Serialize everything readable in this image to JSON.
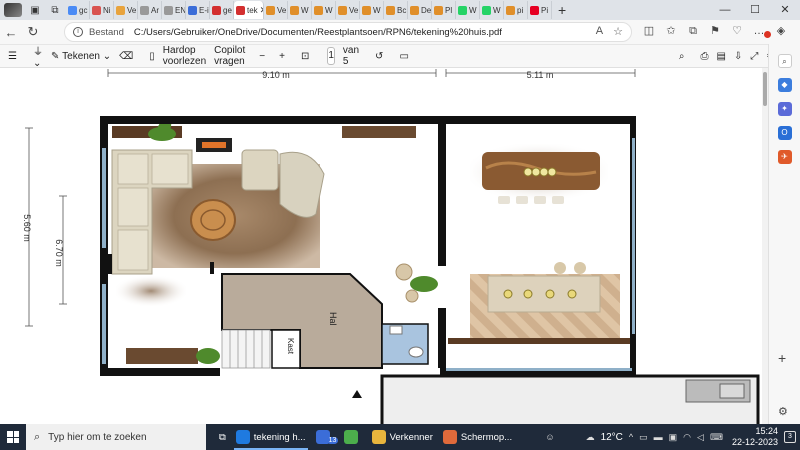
{
  "browser": {
    "tabs": [
      {
        "label": "gc",
        "color": "#4b8bf5"
      },
      {
        "label": "Ni",
        "color": "#d9534f"
      },
      {
        "label": "Ve",
        "color": "#e8a33d"
      },
      {
        "label": "Ar",
        "color": "#999999"
      },
      {
        "label": "EN",
        "color": "#999999"
      },
      {
        "label": "E-i",
        "color": "#3b6dd8"
      },
      {
        "label": "ge",
        "color": "#d32f2f"
      },
      {
        "label": "tek",
        "color": "#d32f2f",
        "active": true
      },
      {
        "label": "Ve",
        "color": "#e08f2a"
      },
      {
        "label": "W",
        "color": "#e08f2a"
      },
      {
        "label": "W",
        "color": "#e08f2a"
      },
      {
        "label": "Ve",
        "color": "#e08f2a"
      },
      {
        "label": "W",
        "color": "#e08f2a"
      },
      {
        "label": "Bc",
        "color": "#e08f2a"
      },
      {
        "label": "De",
        "color": "#e08f2a"
      },
      {
        "label": "Pl",
        "color": "#e08f2a"
      },
      {
        "label": "W",
        "color": "#25d366"
      },
      {
        "label": "W",
        "color": "#25d366"
      },
      {
        "label": "pi",
        "color": "#e08f2a"
      },
      {
        "label": "Pi",
        "color": "#e60023"
      }
    ],
    "address": {
      "site_label": "Bestand",
      "url": "C:/Users/Gebruiker/OneDrive/Documenten/Reestplantsoen/RPN6/tekening%20huis.pdf"
    }
  },
  "pdf_toolbar": {
    "draw_label": "Tekenen",
    "read_aloud": "Hardop voorlezen",
    "copilot": "Copilot vragen",
    "minus": "−",
    "plus": "+",
    "page_current": "1",
    "page_total": "van 5"
  },
  "plan": {
    "dim_top_left": "9.10 m",
    "dim_top_right": "5.11 m",
    "dim_left_outer": "5.60 m",
    "dim_left_inner": "6.70 m",
    "label_hal": "Hal",
    "label_kast": "Kast"
  },
  "taskbar": {
    "search_placeholder": "Typ hier om te zoeken",
    "apps": [
      {
        "label": "tekening h...",
        "color": "#1f7ae0",
        "active": true
      },
      {
        "label": "",
        "color": "#3b6dd8",
        "badge": "13"
      },
      {
        "label": "",
        "color": "#4cae4c"
      },
      {
        "label": "Verkenner",
        "color": "#e8b53d"
      },
      {
        "label": "Schermop...",
        "color": "#e06a3b"
      }
    ],
    "weather": "12°C",
    "time": "15:24",
    "date": "22-12-2023",
    "notifications": "3"
  },
  "colors": {
    "wall": "#111111",
    "floor_wood": "#c9a67a",
    "hall_floor": "#b9ab9b",
    "window": "#8fb0c8",
    "taskbar": "#1f2a3a"
  }
}
